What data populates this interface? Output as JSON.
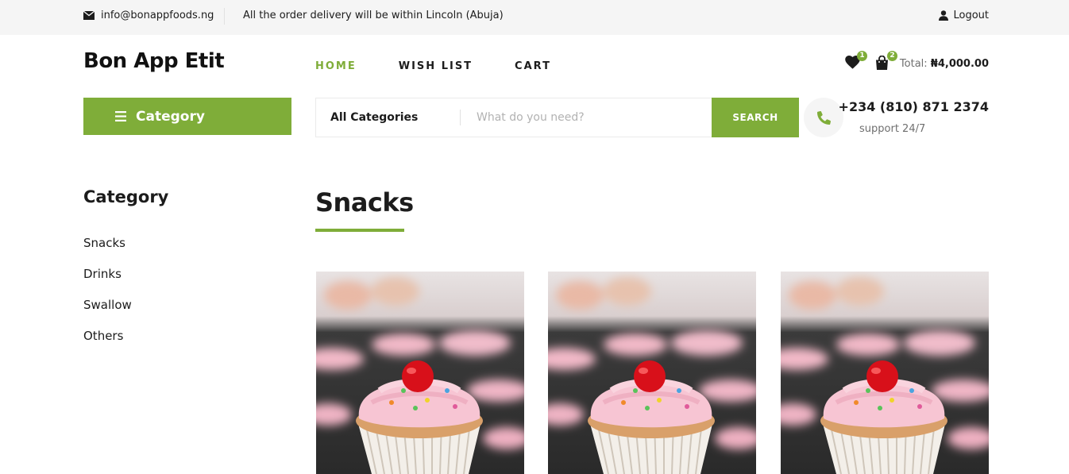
{
  "topbar": {
    "email": "info@bonappfoods.ng",
    "notice": "All the order delivery will be within Lincoln (Abuja)",
    "logout": "Logout"
  },
  "header": {
    "logo": "Bon App Etit",
    "nav": [
      {
        "label": "HOME",
        "active": true
      },
      {
        "label": "WISH LIST",
        "active": false
      },
      {
        "label": "CART",
        "active": false
      }
    ],
    "wishlist_count": "1",
    "cart_count": "2",
    "total_label": "Total:",
    "total_value": "₦4,000.00"
  },
  "category_button": "Category",
  "search": {
    "category": "All Categories",
    "placeholder": "What do you need?",
    "button": "SEARCH"
  },
  "phone": {
    "number": "+234 (810) 871 2374",
    "support": "support 24/7"
  },
  "sidebar": {
    "title": "Category",
    "items": [
      "Snacks",
      "Drinks",
      "Swallow",
      "Others"
    ]
  },
  "section": {
    "title": "Snacks"
  },
  "colors": {
    "accent": "#7fad39",
    "topbar_bg": "#f5f5f5"
  },
  "icons": {
    "email": "envelope-icon",
    "logout": "user-icon",
    "wishlist": "heart-icon",
    "cart": "shopping-bag-icon",
    "menu": "bars-icon",
    "phone": "phone-icon"
  }
}
